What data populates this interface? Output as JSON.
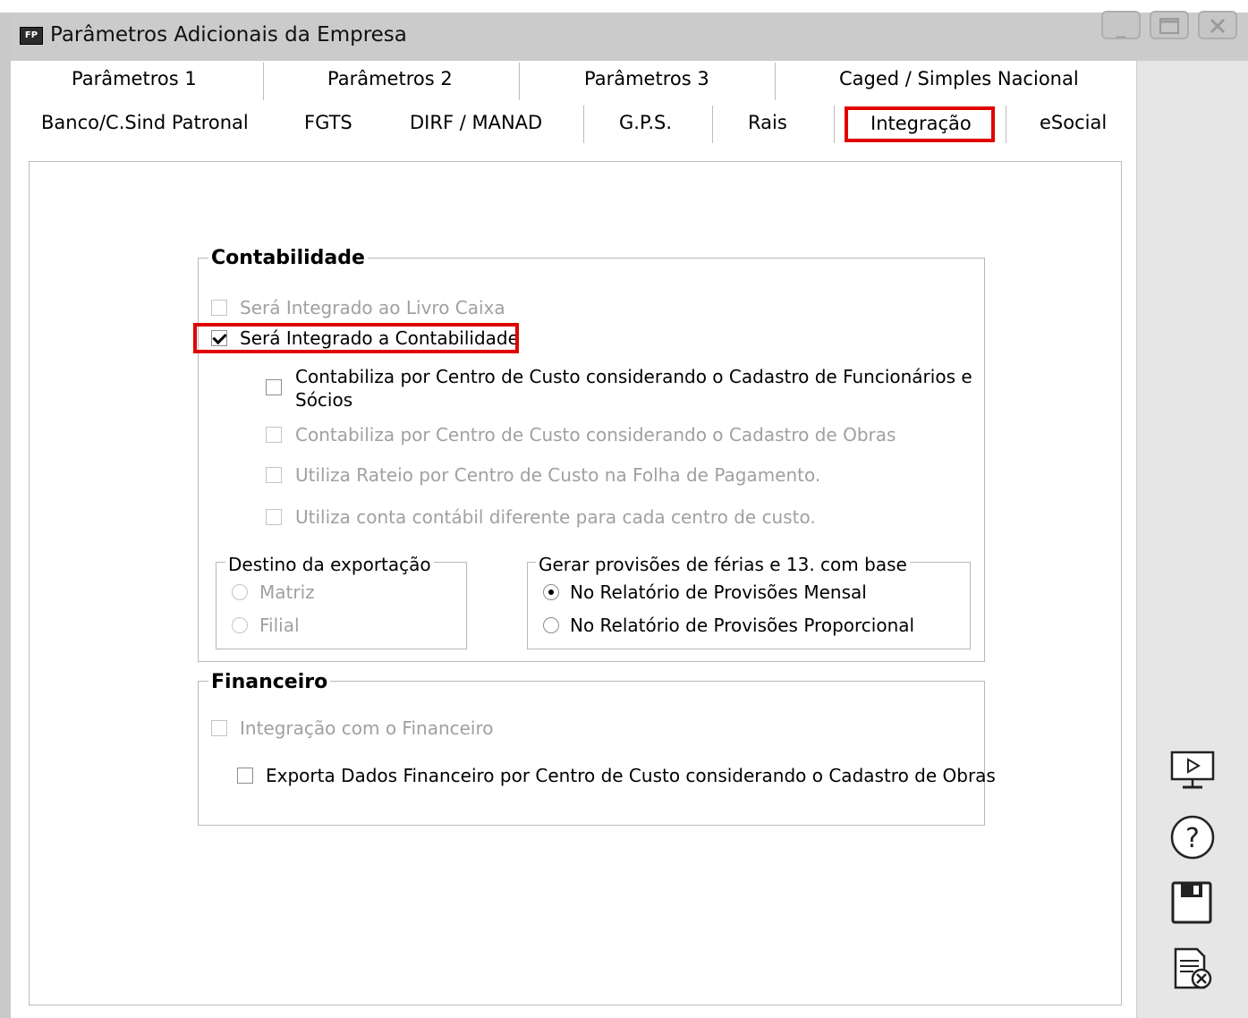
{
  "window": {
    "app_badge": "FP",
    "title": "Parâmetros Adicionais da Empresa"
  },
  "tabs": {
    "row1": [
      {
        "label": "Parâmetros 1"
      },
      {
        "label": "Parâmetros 2"
      },
      {
        "label": "Parâmetros 3"
      },
      {
        "label": "Caged / Simples Nacional"
      }
    ],
    "row2": [
      {
        "label": "Banco/C.Sind Patronal"
      },
      {
        "label": "FGTS"
      },
      {
        "label": "DIRF / MANAD"
      },
      {
        "label": "G.P.S."
      },
      {
        "label": "Rais"
      },
      {
        "label": "Integração"
      },
      {
        "label": "eSocial"
      }
    ],
    "active": "Integração"
  },
  "contabilidade": {
    "title": "Contabilidade",
    "livro_caixa": {
      "label": "Será Integrado ao Livro Caixa",
      "checked": false,
      "enabled": false
    },
    "contabilidade": {
      "label": "Será Integrado a Contabilidade",
      "checked": true,
      "enabled": true
    },
    "centro_custo_func": {
      "line1": "Contabiliza por Centro de Custo considerando o Cadastro de Funcionários e",
      "line2": "Sócios",
      "checked": false,
      "enabled": true
    },
    "centro_custo_obras": {
      "label": "Contabiliza por Centro de Custo considerando o Cadastro de Obras",
      "checked": false,
      "enabled": false
    },
    "rateio": {
      "label": "Utiliza Rateio por Centro de Custo na Folha de Pagamento.",
      "checked": false,
      "enabled": false
    },
    "conta_contabil": {
      "label": "Utiliza conta contábil diferente para cada centro de custo.",
      "checked": false,
      "enabled": false
    },
    "destino": {
      "title": "Destino da exportação",
      "options": [
        {
          "label": "Matriz",
          "selected": false,
          "enabled": false
        },
        {
          "label": "Filial",
          "selected": false,
          "enabled": false
        }
      ]
    },
    "provisoes": {
      "title": "Gerar provisões de férias e 13. com base",
      "options": [
        {
          "label": "No Relatório de Provisões Mensal",
          "selected": true,
          "enabled": true
        },
        {
          "label": "No Relatório de Provisões Proporcional",
          "selected": false,
          "enabled": true
        }
      ]
    }
  },
  "financeiro": {
    "title": "Financeiro",
    "integracao": {
      "label": "Integração com o Financeiro",
      "checked": false,
      "enabled": false
    },
    "exporta": {
      "label": "Exporta Dados Financeiro por Centro de Custo considerando o Cadastro de Obras",
      "checked": false,
      "enabled": true
    }
  },
  "sidebar_icons": [
    "presentation-icon",
    "help-icon",
    "save-icon",
    "cancel-document-icon"
  ],
  "colors": {
    "highlight": "#e00000",
    "titlebar": "#cbcbcb",
    "disabled_text": "#a0a0a0"
  }
}
